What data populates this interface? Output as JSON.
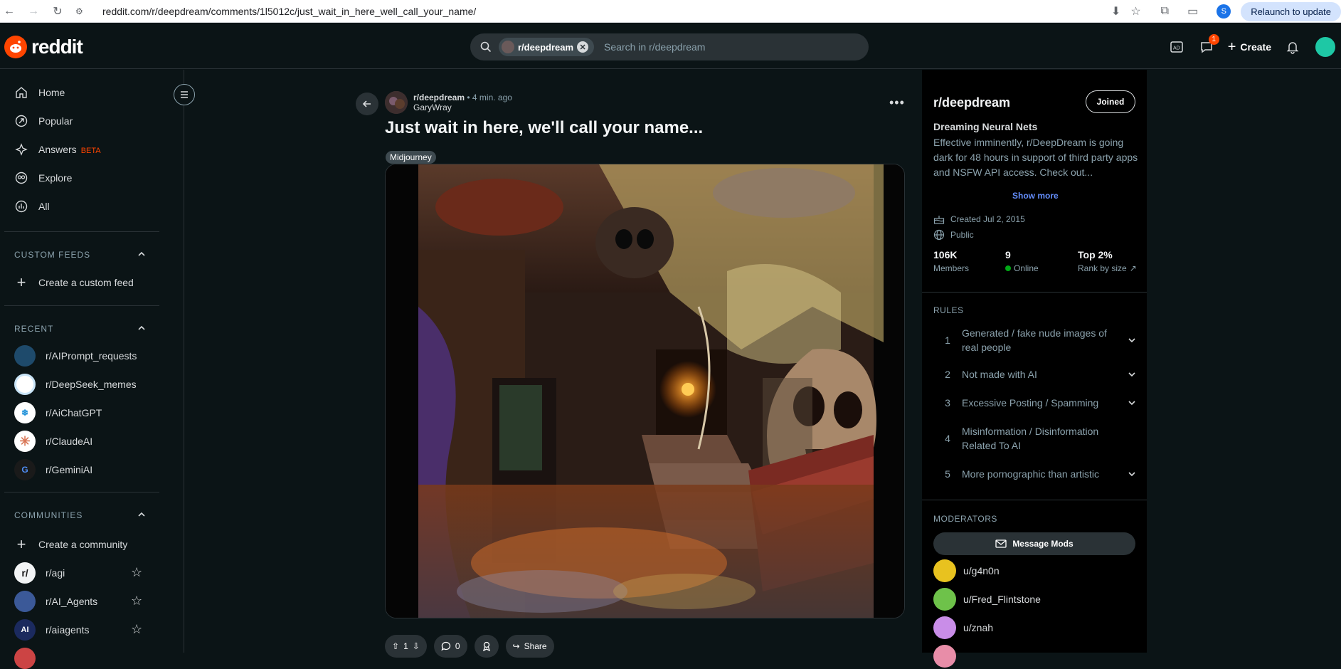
{
  "browser": {
    "url": "reddit.com/r/deepdream/comments/1l5012c/just_wait_in_here_well_call_your_name/",
    "profile_initial": "S",
    "relaunch_label": "Relaunch to update"
  },
  "header": {
    "logo_text": "reddit",
    "search_chip": "r/deepdream",
    "search_placeholder": "Search in r/deepdream",
    "chat_badge": "1",
    "create_label": "Create"
  },
  "sidebar": {
    "nav": [
      {
        "label": "Home",
        "icon": "home-icon"
      },
      {
        "label": "Popular",
        "icon": "popular-icon"
      },
      {
        "label": "Answers",
        "icon": "answers-icon",
        "badge": "BETA"
      },
      {
        "label": "Explore",
        "icon": "explore-icon"
      },
      {
        "label": "All",
        "icon": "all-icon"
      }
    ],
    "custom_feeds_label": "CUSTOM FEEDS",
    "create_feed_label": "Create a custom feed",
    "recent_label": "RECENT",
    "recent": [
      {
        "name": "r/AIPrompt_requests",
        "color": "#1e4a6b"
      },
      {
        "name": "r/DeepSeek_memes",
        "color": "#ffffff"
      },
      {
        "name": "r/AiChatGPT",
        "color": "#ffffff"
      },
      {
        "name": "r/ClaudeAI",
        "color": "#ffffff"
      },
      {
        "name": "r/GeminiAI",
        "color": "#1a1a1a"
      }
    ],
    "communities_label": "COMMUNITIES",
    "create_community_label": "Create a community",
    "communities": [
      {
        "name": "r/agi",
        "icon_text": "r/",
        "color": "#f2f4f5"
      },
      {
        "name": "r/AI_Agents",
        "icon_text": "",
        "color": "#3b5998"
      },
      {
        "name": "r/aiagents",
        "icon_text": "AI",
        "color": "#1b2a5e"
      }
    ]
  },
  "post": {
    "subreddit": "r/deepdream",
    "time": "4 min. ago",
    "author": "GaryWray",
    "title": "Just wait in here, we'll call your name...",
    "flair": "Midjourney",
    "votes": "1",
    "comments": "0",
    "share_label": "Share"
  },
  "community": {
    "name": "r/deepdream",
    "joined_label": "Joined",
    "tagline": "Dreaming Neural Nets",
    "description": "Effective imminently, r/DeepDream is going dark for 48 hours in support of third party apps and NSFW API access. Check out...",
    "show_more": "Show more",
    "created": "Created Jul 2, 2015",
    "visibility": "Public",
    "stats": [
      {
        "value": "106K",
        "label": "Members"
      },
      {
        "value": "9",
        "label": "Online"
      },
      {
        "value": "Top 2%",
        "label": "Rank by size"
      }
    ],
    "rules_label": "RULES",
    "rules": [
      {
        "n": "1",
        "text": "Generated / fake nude images of real people"
      },
      {
        "n": "2",
        "text": "Not made with AI"
      },
      {
        "n": "3",
        "text": "Excessive Posting / Spamming"
      },
      {
        "n": "4",
        "text": "Misinformation / Disinformation Related To AI"
      },
      {
        "n": "5",
        "text": "More pornographic than artistic"
      }
    ],
    "moderators_label": "MODERATORS",
    "message_mods": "Message Mods",
    "moderators": [
      {
        "name": "u/g4n0n",
        "color": "#e8c21f"
      },
      {
        "name": "u/Fred_Flintstone",
        "color": "#6ec24a"
      },
      {
        "name": "u/znah",
        "color": "#c98de8"
      }
    ]
  }
}
